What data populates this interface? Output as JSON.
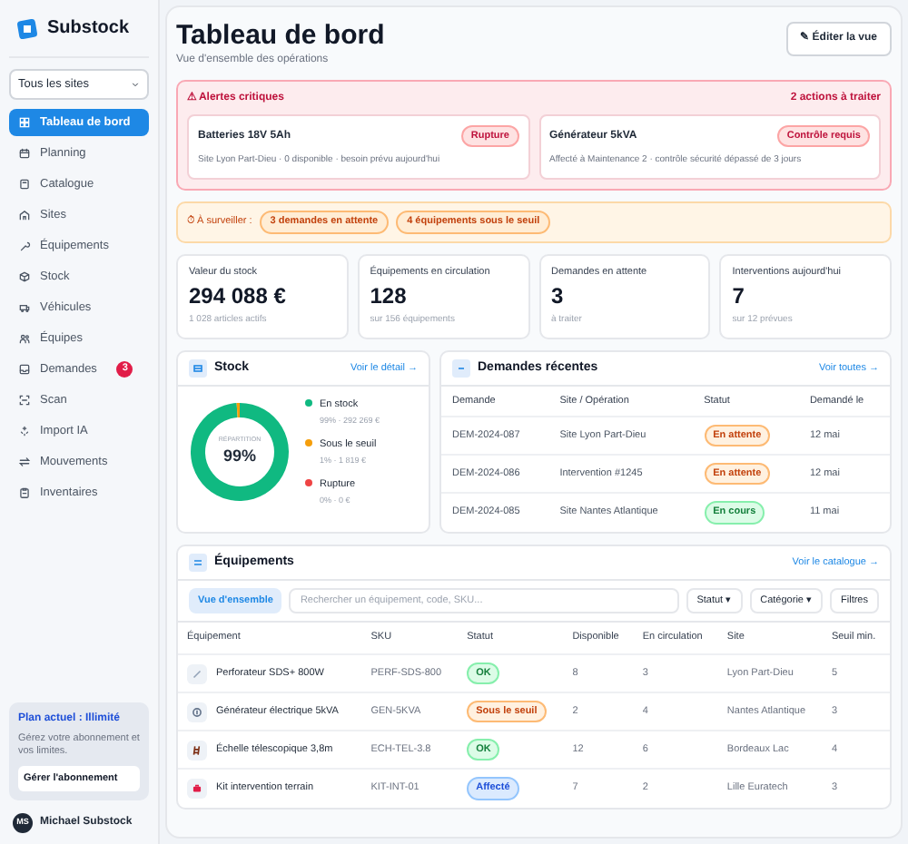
{
  "sidebar": {
    "brand": "Substock",
    "site_select": "Tous les sites",
    "items": [
      {
        "label": "Tableau de bord",
        "selected": true
      },
      {
        "label": "Planning",
        "selected": false
      },
      {
        "label": "Catalogue",
        "selected": false
      },
      {
        "label": "Sites",
        "selected": false
      },
      {
        "label": "Équipements",
        "selected": false
      },
      {
        "label": "Stock",
        "selected": false
      },
      {
        "label": "Véhicules",
        "selected": false
      },
      {
        "label": "Équipes",
        "selected": false
      },
      {
        "label": "Demandes",
        "selected": false,
        "badge": "3"
      },
      {
        "label": "Scan",
        "selected": false
      },
      {
        "label": "Import IA",
        "selected": false
      },
      {
        "label": "Mouvements",
        "selected": false
      },
      {
        "label": "Inventaires",
        "selected": false
      }
    ],
    "plan": {
      "title": "Plan actuel : Illimité",
      "text": "Gérez votre abonnement et vos limites.",
      "button": "Gérer l'abonnement"
    },
    "user": {
      "initials": "MS",
      "name": "Michael Substock"
    }
  },
  "header": {
    "title": "Tableau de bord",
    "subtitle": "Vue d'ensemble des opérations",
    "button": "✎ Éditer la vue"
  },
  "alerts": {
    "title": "⚠ Alertes critiques",
    "count": "2 actions à traiter",
    "items": [
      {
        "name": "Batteries 18V 5Ah",
        "tag": "Rupture",
        "detail": "Site Lyon Part-Dieu · 0 disponible · besoin prévu aujourd'hui"
      },
      {
        "name": "Générateur 5kVA",
        "tag": "Contrôle requis",
        "detail": "Affecté à Maintenance 2 · contrôle sécurité dépassé de 3 jours"
      }
    ]
  },
  "watch": {
    "label": "⏱ À surveiller :",
    "chips": [
      "3 demandes en attente",
      "4 équipements sous le seuil"
    ]
  },
  "kpis": [
    {
      "label": "Valeur du stock",
      "value": "294 088 €",
      "sub": "1 028 articles actifs"
    },
    {
      "label": "Équipements en circulation",
      "value": "128",
      "sub": "sur 156 équipements"
    },
    {
      "label": "Demandes en attente",
      "value": "3",
      "sub": "à traiter"
    },
    {
      "label": "Interventions aujourd'hui",
      "value": "7",
      "sub": "sur 12 prévues"
    }
  ],
  "stock": {
    "title": "Stock",
    "link": "Voir le détail →",
    "center_label": "RÉPARTITION",
    "center_value": "99%",
    "chart_data": {
      "type": "donut",
      "categories": [
        "En stock",
        "Sous le seuil",
        "Rupture"
      ],
      "values": [
        99,
        1,
        0
      ]
    },
    "legend": [
      {
        "color": "#10b981",
        "detail": "99% · 292 269 €"
      },
      {
        "color": "#f59e0b",
        "detail": "1% · 1 819 €"
      },
      {
        "color": "#ef4444",
        "detail": "0% · 0 €"
      }
    ]
  },
  "requests": {
    "title": "Demandes récentes",
    "link": "Voir toutes →",
    "columns": [
      "Demande",
      "Site / Opération",
      "Statut",
      "Demandé le"
    ],
    "rows": [
      {
        "id": "DEM-2024-087",
        "site": "Site Lyon Part-Dieu",
        "status": "En attente",
        "kind": "warning",
        "date": "12 mai"
      },
      {
        "id": "DEM-2024-086",
        "site": "Intervention #1245",
        "status": "En attente",
        "kind": "warning",
        "date": "12 mai"
      },
      {
        "id": "DEM-2024-085",
        "site": "Site Nantes Atlantique",
        "status": "En cours",
        "kind": "success",
        "date": "11 mai"
      }
    ]
  },
  "equipment": {
    "title": "Équipements",
    "link": "Voir le catalogue →",
    "view_tab": "Vue d'ensemble",
    "search": {
      "placeholder": "Rechercher un équipement, code, SKU..."
    },
    "filters": [
      "Statut ▾",
      "Catégorie ▾",
      "Filtres"
    ],
    "columns": [
      "Équipement",
      "SKU",
      "Statut",
      "Disponible",
      "En circulation",
      "Site",
      "Seuil min."
    ],
    "rows": [
      {
        "name": "Perforateur SDS+ 800W",
        "sku": "PERF-SDS-800",
        "status": "OK",
        "kind": "success",
        "available": "8",
        "circulating": "3",
        "site": "Lyon Part-Dieu",
        "min": "5"
      },
      {
        "name": "Générateur électrique 5kVA",
        "sku": "GEN-5KVA",
        "status": "Sous le seuil",
        "kind": "warning",
        "available": "2",
        "circulating": "4",
        "site": "Nantes Atlantique",
        "min": "3"
      },
      {
        "name": "Échelle télescopique 3,8m",
        "sku": "ECH-TEL-3.8",
        "status": "OK",
        "kind": "success",
        "available": "12",
        "circulating": "6",
        "site": "Bordeaux Lac",
        "min": "4"
      },
      {
        "name": "Kit intervention terrain",
        "sku": "KIT-INT-01",
        "status": "Affecté",
        "kind": "info",
        "available": "7",
        "circulating": "2",
        "site": "Lille Euratech",
        "min": "3"
      }
    ]
  }
}
